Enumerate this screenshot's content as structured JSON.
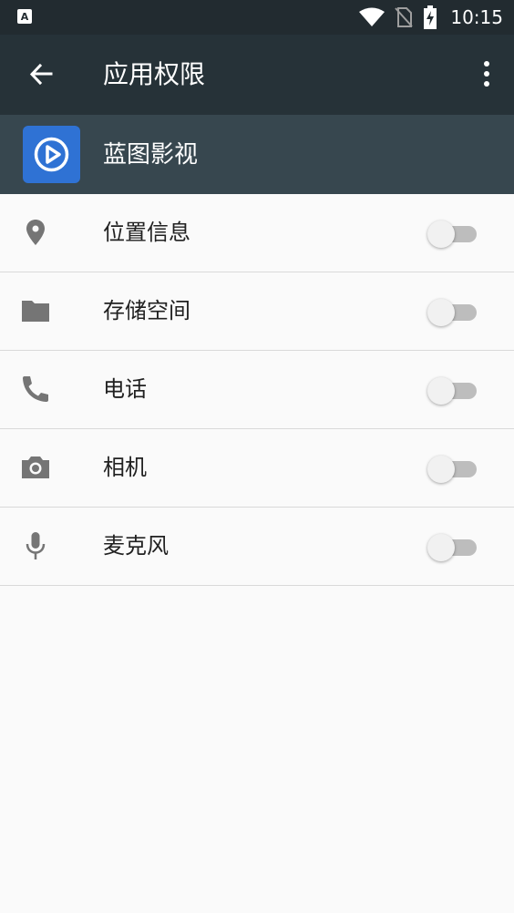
{
  "status_bar": {
    "time": "10:15",
    "icons": [
      "notification-a-icon",
      "wifi-icon",
      "no-sim-icon",
      "battery-charging-icon"
    ]
  },
  "toolbar": {
    "title": "应用权限",
    "back_icon": "arrow-back-icon",
    "more_icon": "more-vert-icon"
  },
  "app": {
    "name": "蓝图影视",
    "icon": "play-logo-icon",
    "icon_color": "#2f72d4"
  },
  "permissions": [
    {
      "label": "位置信息",
      "icon": "location-icon",
      "enabled": false
    },
    {
      "label": "存储空间",
      "icon": "folder-icon",
      "enabled": false
    },
    {
      "label": "电话",
      "icon": "phone-icon",
      "enabled": false
    },
    {
      "label": "相机",
      "icon": "camera-icon",
      "enabled": false
    },
    {
      "label": "麦克风",
      "icon": "microphone-icon",
      "enabled": false
    }
  ],
  "colors": {
    "status_bar": "#222b30",
    "toolbar": "#263238",
    "app_header": "#37474f",
    "background": "#fafafa",
    "icon_gray": "#757575"
  }
}
